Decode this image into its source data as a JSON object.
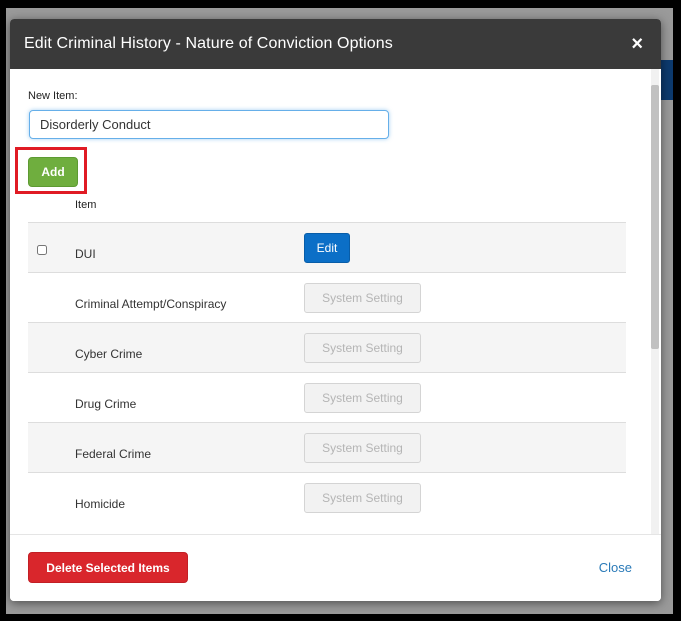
{
  "modal": {
    "title": "Edit Criminal History - Nature of Conviction Options",
    "close_icon": "×"
  },
  "form": {
    "new_item_label": "New Item:",
    "new_item_value": "Disorderly Conduct",
    "add_label": "Add"
  },
  "table": {
    "column_header": "Item",
    "rows": [
      {
        "name": "DUI",
        "action": "Edit"
      },
      {
        "name": "Criminal Attempt/Conspiracy",
        "action": "System Setting"
      },
      {
        "name": "Cyber Crime",
        "action": "System Setting"
      },
      {
        "name": "Drug Crime",
        "action": "System Setting"
      },
      {
        "name": "Federal Crime",
        "action": "System Setting"
      },
      {
        "name": "Homicide",
        "action": "System Setting"
      }
    ]
  },
  "footer": {
    "delete_label": "Delete Selected Items",
    "close_label": "Close"
  },
  "colors": {
    "header_bg": "#3a3a3a",
    "add_green": "#6fae3e",
    "edit_blue": "#0b6fc7",
    "delete_red": "#d9262c",
    "highlight_red": "#e01b24",
    "link_blue": "#2a7ab8"
  },
  "icons": {
    "close": "close-icon",
    "checkbox": "checkbox-icon"
  }
}
